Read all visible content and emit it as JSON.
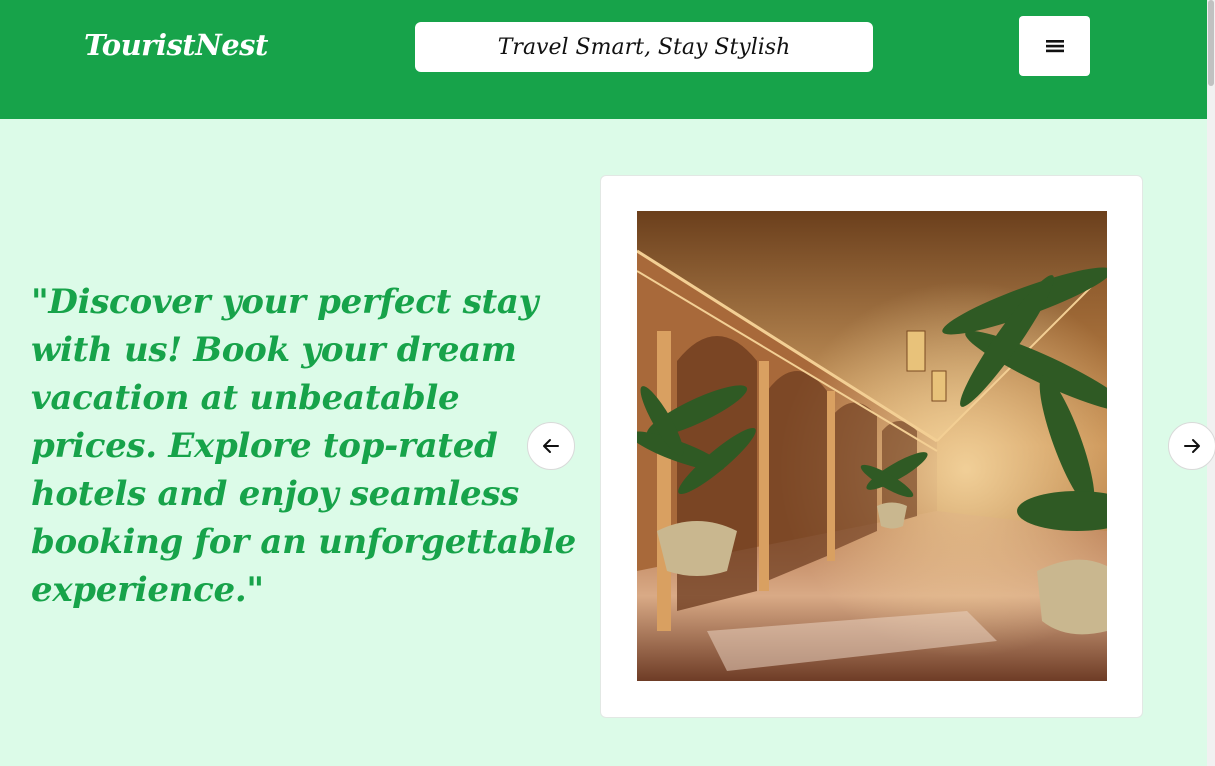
{
  "header": {
    "brand": "TouristNest",
    "tagline": "Travel Smart, Stay Stylish",
    "menu_icon": "hamburger-menu-icon"
  },
  "hero": {
    "quote": "\"Discover your perfect stay with us! Book your dream vacation at unbeatable prices. Explore top-rated hotels and enjoy seamless booking for an unforgettable experience.\"",
    "carousel": {
      "prev_icon": "arrow-left-icon",
      "next_icon": "arrow-right-icon"
    }
  },
  "colors": {
    "primary_green": "#17a34a",
    "background_mint": "#dcfbe8",
    "white": "#ffffff"
  }
}
